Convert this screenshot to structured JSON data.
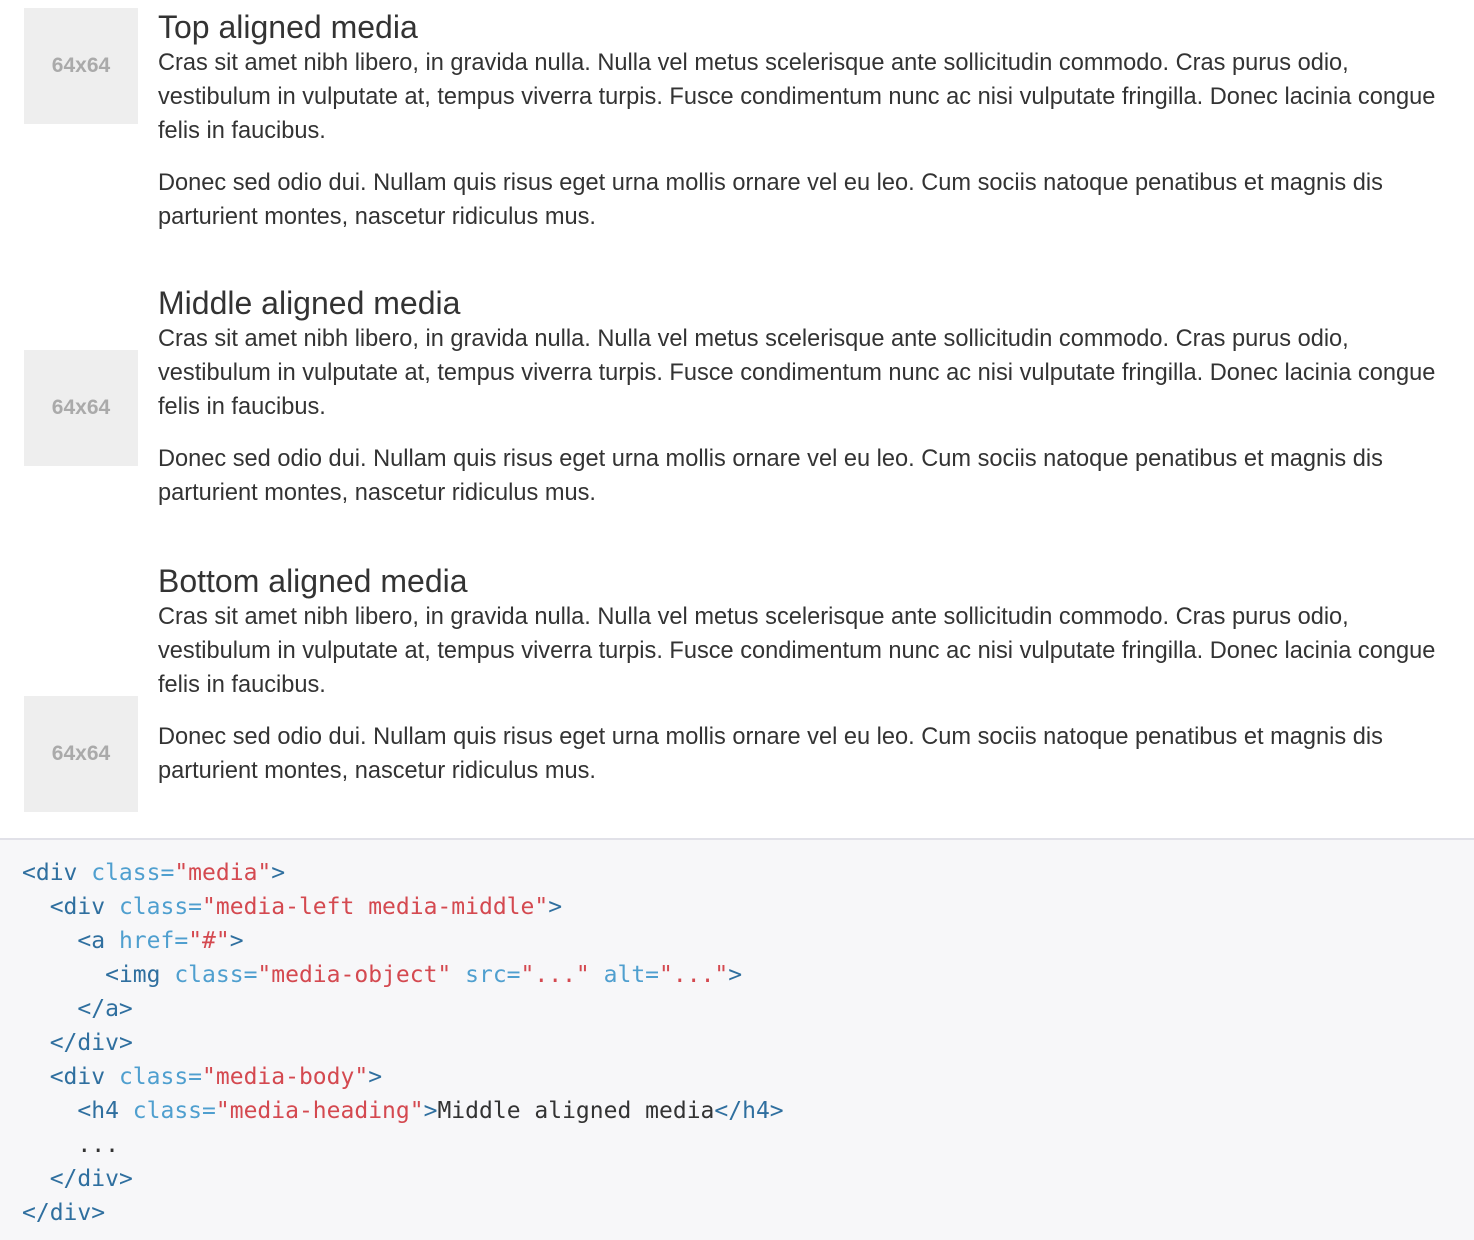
{
  "placeholder_label": "64x64",
  "media_items": [
    {
      "heading": "Top aligned media",
      "paragraphs": [
        "Cras sit amet nibh libero, in gravida nulla. Nulla vel metus scelerisque ante sollicitudin commodo. Cras purus odio, vestibulum in vulputate at, tempus viverra turpis. Fusce condimentum nunc ac nisi vulputate fringilla. Donec lacinia congue felis in faucibus.",
        "Donec sed odio dui. Nullam quis risus eget urna mollis ornare vel eu leo. Cum sociis natoque penatibus et magnis dis parturient montes, nascetur ridiculus mus."
      ]
    },
    {
      "heading": "Middle aligned media",
      "paragraphs": [
        "Cras sit amet nibh libero, in gravida nulla. Nulla vel metus scelerisque ante sollicitudin commodo. Cras purus odio, vestibulum in vulputate at, tempus viverra turpis. Fusce condimentum nunc ac nisi vulputate fringilla. Donec lacinia congue felis in faucibus.",
        "Donec sed odio dui. Nullam quis risus eget urna mollis ornare vel eu leo. Cum sociis natoque penatibus et magnis dis parturient montes, nascetur ridiculus mus."
      ]
    },
    {
      "heading": "Bottom aligned media",
      "paragraphs": [
        "Cras sit amet nibh libero, in gravida nulla. Nulla vel metus scelerisque ante sollicitudin commodo. Cras purus odio, vestibulum in vulputate at, tempus viverra turpis. Fusce condimentum nunc ac nisi vulputate fringilla. Donec lacinia congue felis in faucibus.",
        "Donec sed odio dui. Nullam quis risus eget urna mollis ornare vel eu leo. Cum sociis natoque penatibus et magnis dis parturient montes, nascetur ridiculus mus."
      ]
    }
  ],
  "code": {
    "l1_tag_open": "<div",
    "l1_attr": " class=",
    "l1_val": "\"media\"",
    "l1_close": ">",
    "l2_tag_open": "<div",
    "l2_attr": " class=",
    "l2_val": "\"media-left media-middle\"",
    "l2_close": ">",
    "l3_tag_open": "<a",
    "l3_attr": " href=",
    "l3_val": "\"#\"",
    "l3_close": ">",
    "l4_tag_open": "<img",
    "l4_attr1": " class=",
    "l4_val1": "\"media-object\"",
    "l4_attr2": " src=",
    "l4_val2": "\"...\"",
    "l4_attr3": " alt=",
    "l4_val3": "\"...\"",
    "l4_close": ">",
    "l5_tag": "</a>",
    "l6_tag": "</div>",
    "l7_tag_open": "<div",
    "l7_attr": " class=",
    "l7_val": "\"media-body\"",
    "l7_close": ">",
    "l8_tag_open": "<h4",
    "l8_attr": " class=",
    "l8_val": "\"media-heading\"",
    "l8_close": ">",
    "l8_text": "Middle aligned media",
    "l8_end": "</h4>",
    "l9_text": "...",
    "l10_tag": "</div>",
    "l11_tag": "</div>"
  }
}
